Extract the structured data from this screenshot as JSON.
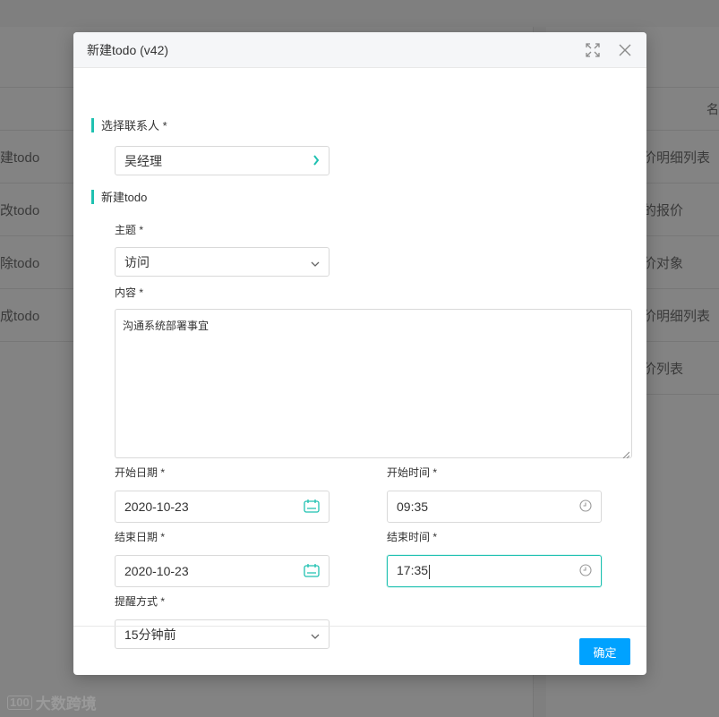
{
  "background": {
    "left_rows": [
      "建todo",
      "改todo",
      "除todo",
      "成todo"
    ],
    "right_header": "名",
    "right_rows": [
      "价明细列表",
      "的报价",
      "价对象",
      "价明细列表",
      "价列表"
    ]
  },
  "watermark": {
    "logo": "100",
    "text": "大数跨境"
  },
  "modal": {
    "title": "新建todo (v42)",
    "section_contact": {
      "title": "选择联系人 *",
      "value": "吴经理"
    },
    "section_todo": {
      "title": "新建todo"
    },
    "subject": {
      "label": "主题 *",
      "value": "访问"
    },
    "content": {
      "label": "内容 *",
      "value": "沟通系统部署事宜"
    },
    "start_date": {
      "label": "开始日期 *",
      "value": "2020-10-23"
    },
    "start_time": {
      "label": "开始时间 *",
      "value": "09:35"
    },
    "end_date": {
      "label": "结束日期 *",
      "value": "2020-10-23"
    },
    "end_time": {
      "label": "结束时间 *",
      "value": "17:35"
    },
    "reminder": {
      "label": "提醒方式 *",
      "value": "15分钟前"
    },
    "ok_label": "确定"
  },
  "colors": {
    "accent": "#1fc1b1",
    "primary_button": "#00a2ff",
    "overlay": "#7f7f7f"
  },
  "icons": {
    "expand": "fullscreen-icon",
    "close": "close-icon",
    "calendar": "calendar-icon",
    "clock": "clock-icon",
    "chevron_right": "chevron-right-icon",
    "chevron_down": "chevron-down-icon"
  }
}
